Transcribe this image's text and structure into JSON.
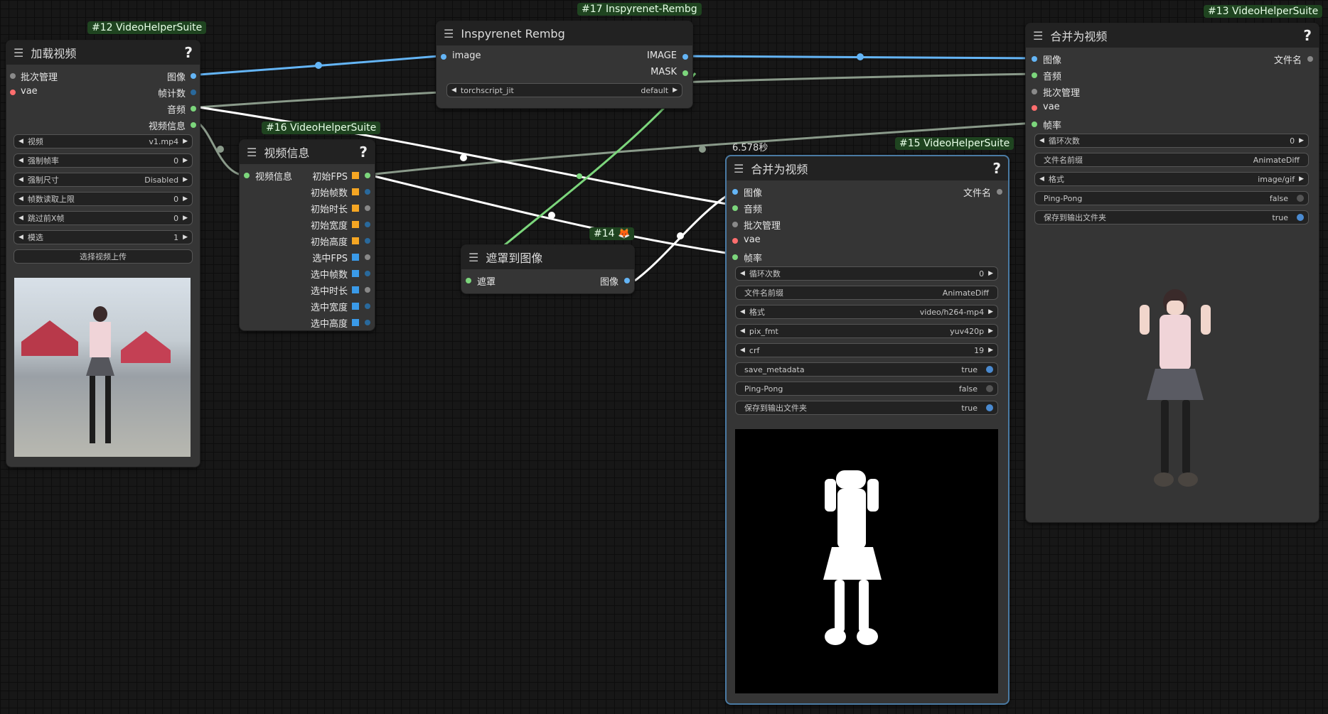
{
  "node12": {
    "badge": "#12 VideoHelperSuite",
    "title": "加载视频",
    "help": "?",
    "inputs": [
      "批次管理",
      "vae"
    ],
    "outputs": [
      "图像",
      "帧计数",
      "音频",
      "视频信息"
    ],
    "widgets": [
      {
        "label": "视频",
        "value": "v1.mp4"
      },
      {
        "label": "强制帧率",
        "value": "0"
      },
      {
        "label": "强制尺寸",
        "value": "Disabled"
      },
      {
        "label": "帧数读取上限",
        "value": "0"
      },
      {
        "label": "跳过前X帧",
        "value": "0"
      },
      {
        "label": "模选",
        "value": "1"
      }
    ],
    "upload_button": "选择视频上传"
  },
  "node17": {
    "badge": "#17 Inspyrenet-Rembg",
    "title": "Inspyrenet Rembg",
    "input": "image",
    "outputs": [
      "IMAGE",
      "MASK"
    ],
    "widget": {
      "label": "torchscript_jit",
      "value": "default"
    }
  },
  "node16": {
    "badge": "#16 VideoHelperSuite",
    "title": "视频信息",
    "help": "?",
    "input": "视频信息",
    "outputs": [
      "初始FPS",
      "初始帧数",
      "初始时长",
      "初始宽度",
      "初始高度",
      "选中FPS",
      "选中帧数",
      "选中时长",
      "选中宽度",
      "选中高度"
    ]
  },
  "node14": {
    "badge": "#14 🦊",
    "title": "遮罩到图像",
    "input": "遮罩",
    "output": "图像"
  },
  "node15": {
    "badge": "#15 VideoHelperSuite",
    "timer": "6.578秒",
    "title": "合并为视频",
    "help": "?",
    "inputs": [
      "图像",
      "音频",
      "批次管理",
      "vae",
      "帧率"
    ],
    "output": "文件名",
    "widgets": [
      {
        "label": "循环次数",
        "value": "0",
        "kind": "number"
      },
      {
        "label": "文件名前缀",
        "value": "AnimateDiff",
        "kind": "text"
      },
      {
        "label": "格式",
        "value": "video/h264-mp4",
        "kind": "combo"
      },
      {
        "label": "pix_fmt",
        "value": "yuv420p",
        "kind": "combo"
      },
      {
        "label": "crf",
        "value": "19",
        "kind": "number"
      },
      {
        "label": "save_metadata",
        "value": "true",
        "kind": "toggle"
      },
      {
        "label": "Ping-Pong",
        "value": "false",
        "kind": "toggle"
      },
      {
        "label": "保存到输出文件夹",
        "value": "true",
        "kind": "toggle"
      }
    ]
  },
  "node13": {
    "badge": "#13 VideoHelperSuite",
    "title": "合并为视频",
    "help": "?",
    "inputs": [
      "图像",
      "音频",
      "批次管理",
      "vae",
      "帧率"
    ],
    "output": "文件名",
    "widgets": [
      {
        "label": "循环次数",
        "value": "0",
        "kind": "number"
      },
      {
        "label": "文件名前缀",
        "value": "AnimateDiff",
        "kind": "text"
      },
      {
        "label": "格式",
        "value": "image/gif",
        "kind": "combo"
      },
      {
        "label": "Ping-Pong",
        "value": "false",
        "kind": "toggle"
      },
      {
        "label": "保存到输出文件夹",
        "value": "true",
        "kind": "toggle"
      }
    ]
  },
  "colors": {
    "image": "#64b5f6",
    "audio": "#7cd67c",
    "latent": "#ff9cf9",
    "vae": "#ff6e6e",
    "int": "#29699c",
    "float": "#f5a623",
    "badge": "#1f4420"
  }
}
